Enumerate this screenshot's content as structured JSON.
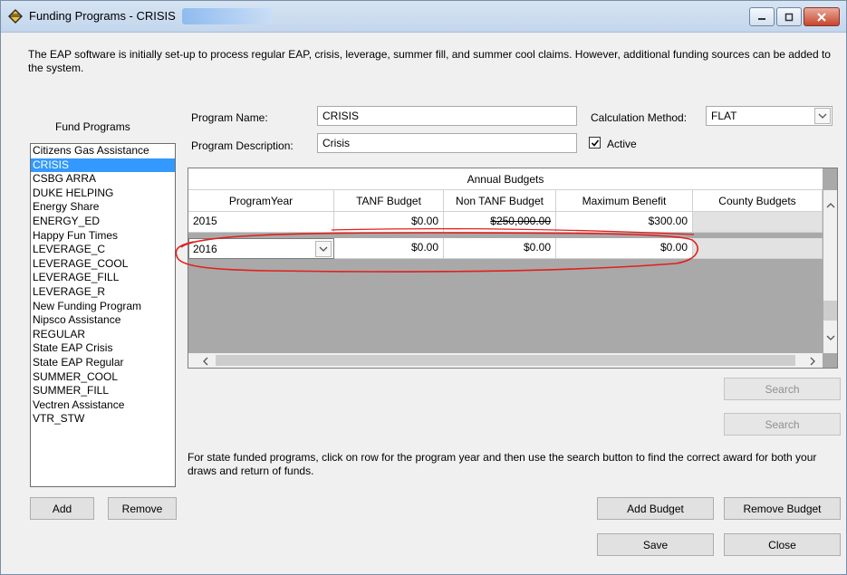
{
  "window": {
    "title": "Funding Programs - CRISIS",
    "minimize_symbol": "▭",
    "maximize_symbol": "▢",
    "close_symbol": "✕"
  },
  "intro_text": "The EAP software is initially set-up to process regular EAP, crisis, leverage, summer fill, and summer cool claims.  However, additional funding sources can be added to the system.",
  "fund_programs": {
    "label": "Fund Programs",
    "selected": "CRISIS",
    "items": [
      "Citizens Gas Assistance",
      "CRISIS",
      "CSBG ARRA",
      "DUKE HELPING",
      "Energy Share",
      "ENERGY_ED",
      "Happy Fun Times",
      "LEVERAGE_C",
      "LEVERAGE_COOL",
      "LEVERAGE_FILL",
      "LEVERAGE_R",
      "New Funding Program",
      "Nipsco Assistance",
      "REGULAR",
      "State EAP Crisis",
      "State EAP Regular",
      "SUMMER_COOL",
      "SUMMER_FILL",
      "Vectren Assistance",
      "VTR_STW"
    ],
    "add_label": "Add",
    "remove_label": "Remove"
  },
  "form": {
    "program_name_label": "Program Name:",
    "program_name_value": "CRISIS",
    "program_description_label": "Program Description:",
    "program_description_value": "Crisis",
    "calculation_method_label": "Calculation Method:",
    "calculation_method_value": "FLAT",
    "active_label": "Active",
    "active_checked": true
  },
  "budgets": {
    "title": "Annual Budgets",
    "columns": [
      "ProgramYear",
      "TANF Budget",
      "Non TANF Budget",
      "Maximum Benefit",
      "County Budgets"
    ],
    "rows": [
      {
        "program_year": "2015",
        "tanf": "$0.00",
        "non_tanf": "$250,000.00",
        "max_benefit": "$300.00",
        "county": ""
      },
      {
        "program_year": "2016",
        "tanf": "$0.00",
        "non_tanf": "$0.00",
        "max_benefit": "$0.00",
        "county": ""
      }
    ]
  },
  "buttons": {
    "search_1": "Search",
    "search_2": "Search",
    "add_budget": "Add Budget",
    "remove_budget": "Remove Budget",
    "save": "Save",
    "close": "Close"
  },
  "footer_text": "For state funded programs, click on row for the program year and then use the search button to find the correct award for both your draws and return of funds.",
  "colors": {
    "selection": "#3399ff",
    "annotation_red": "#e0201c"
  },
  "icons": {
    "app": "winged-diamond-icon",
    "dropdown": "chevron-down-icon",
    "scroll_up": "chevron-up-icon",
    "scroll_down": "chevron-down-icon",
    "scroll_left": "chevron-left-icon",
    "scroll_right": "chevron-right-icon"
  }
}
